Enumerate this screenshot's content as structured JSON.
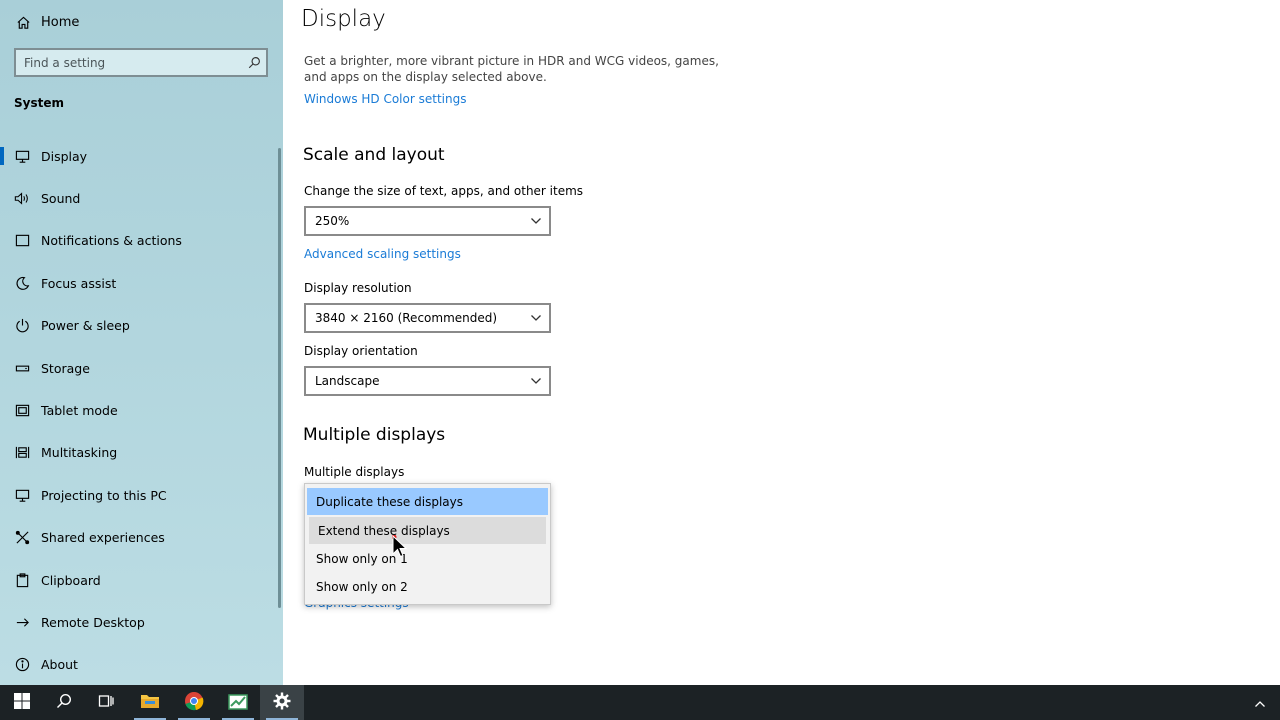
{
  "sidebar": {
    "home_label": "Home",
    "search_placeholder": "Find a setting",
    "section_title": "System",
    "items": [
      {
        "label": "Display",
        "icon": "monitor-icon"
      },
      {
        "label": "Sound",
        "icon": "speaker-icon"
      },
      {
        "label": "Notifications & actions",
        "icon": "notification-icon"
      },
      {
        "label": "Focus assist",
        "icon": "moon-icon"
      },
      {
        "label": "Power & sleep",
        "icon": "power-icon"
      },
      {
        "label": "Storage",
        "icon": "storage-icon"
      },
      {
        "label": "Tablet mode",
        "icon": "tablet-icon"
      },
      {
        "label": "Multitasking",
        "icon": "multitasking-icon"
      },
      {
        "label": "Projecting to this PC",
        "icon": "projecting-icon"
      },
      {
        "label": "Shared experiences",
        "icon": "shared-icon"
      },
      {
        "label": "Clipboard",
        "icon": "clipboard-icon"
      },
      {
        "label": "Remote Desktop",
        "icon": "remote-desktop-icon"
      },
      {
        "label": "About",
        "icon": "info-icon"
      }
    ],
    "active_item": "Display"
  },
  "main": {
    "title": "Display",
    "hdr_description": "Get a brighter, more vibrant picture in HDR and WCG videos, games, and apps on the display selected above.",
    "hdr_link": "Windows HD Color settings",
    "scale_heading": "Scale and layout",
    "scale_label": "Change the size of text, apps, and other items",
    "scale_value": "250%",
    "advanced_scaling_link": "Advanced scaling settings",
    "resolution_label": "Display resolution",
    "resolution_value": "3840 × 2160 (Recommended)",
    "orientation_label": "Display orientation",
    "orientation_value": "Landscape",
    "multi_heading": "Multiple displays",
    "multi_label": "Multiple displays",
    "multi_options": [
      "Duplicate these displays",
      "Extend these displays",
      "Show only on 1",
      "Show only on 2"
    ],
    "multi_selected": "Duplicate these displays",
    "multi_hovered": "Extend these displays",
    "graphics_link": "Graphics settings"
  },
  "taskbar": {
    "apps": [
      "start-icon",
      "search-icon",
      "task-view-icon",
      "file-explorer-icon",
      "chrome-icon",
      "app-icon",
      "settings-icon"
    ],
    "active_app": "settings-icon"
  },
  "colors": {
    "accent": "#0067c0",
    "link": "#1a7bd6",
    "selected_option": "#99c9ff",
    "sidebar_bg": "#b2d6de",
    "taskbar_bg": "#1c2225"
  }
}
